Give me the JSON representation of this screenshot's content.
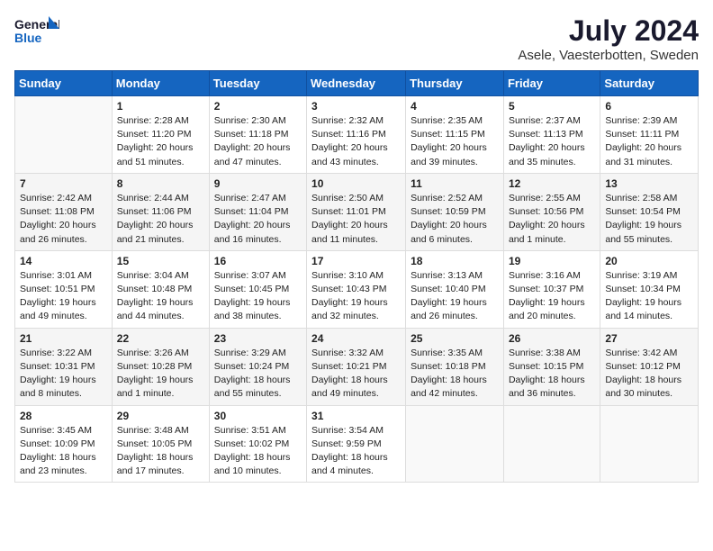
{
  "header": {
    "logo_line1": "General",
    "logo_line2": "Blue",
    "month": "July 2024",
    "location": "Asele, Vaesterbotten, Sweden"
  },
  "weekdays": [
    "Sunday",
    "Monday",
    "Tuesday",
    "Wednesday",
    "Thursday",
    "Friday",
    "Saturday"
  ],
  "weeks": [
    [
      {
        "day": "",
        "data": ""
      },
      {
        "day": "1",
        "data": "Sunrise: 2:28 AM\nSunset: 11:20 PM\nDaylight: 20 hours\nand 51 minutes."
      },
      {
        "day": "2",
        "data": "Sunrise: 2:30 AM\nSunset: 11:18 PM\nDaylight: 20 hours\nand 47 minutes."
      },
      {
        "day": "3",
        "data": "Sunrise: 2:32 AM\nSunset: 11:16 PM\nDaylight: 20 hours\nand 43 minutes."
      },
      {
        "day": "4",
        "data": "Sunrise: 2:35 AM\nSunset: 11:15 PM\nDaylight: 20 hours\nand 39 minutes."
      },
      {
        "day": "5",
        "data": "Sunrise: 2:37 AM\nSunset: 11:13 PM\nDaylight: 20 hours\nand 35 minutes."
      },
      {
        "day": "6",
        "data": "Sunrise: 2:39 AM\nSunset: 11:11 PM\nDaylight: 20 hours\nand 31 minutes."
      }
    ],
    [
      {
        "day": "7",
        "data": "Sunrise: 2:42 AM\nSunset: 11:08 PM\nDaylight: 20 hours\nand 26 minutes."
      },
      {
        "day": "8",
        "data": "Sunrise: 2:44 AM\nSunset: 11:06 PM\nDaylight: 20 hours\nand 21 minutes."
      },
      {
        "day": "9",
        "data": "Sunrise: 2:47 AM\nSunset: 11:04 PM\nDaylight: 20 hours\nand 16 minutes."
      },
      {
        "day": "10",
        "data": "Sunrise: 2:50 AM\nSunset: 11:01 PM\nDaylight: 20 hours\nand 11 minutes."
      },
      {
        "day": "11",
        "data": "Sunrise: 2:52 AM\nSunset: 10:59 PM\nDaylight: 20 hours\nand 6 minutes."
      },
      {
        "day": "12",
        "data": "Sunrise: 2:55 AM\nSunset: 10:56 PM\nDaylight: 20 hours\nand 1 minute."
      },
      {
        "day": "13",
        "data": "Sunrise: 2:58 AM\nSunset: 10:54 PM\nDaylight: 19 hours\nand 55 minutes."
      }
    ],
    [
      {
        "day": "14",
        "data": "Sunrise: 3:01 AM\nSunset: 10:51 PM\nDaylight: 19 hours\nand 49 minutes."
      },
      {
        "day": "15",
        "data": "Sunrise: 3:04 AM\nSunset: 10:48 PM\nDaylight: 19 hours\nand 44 minutes."
      },
      {
        "day": "16",
        "data": "Sunrise: 3:07 AM\nSunset: 10:45 PM\nDaylight: 19 hours\nand 38 minutes."
      },
      {
        "day": "17",
        "data": "Sunrise: 3:10 AM\nSunset: 10:43 PM\nDaylight: 19 hours\nand 32 minutes."
      },
      {
        "day": "18",
        "data": "Sunrise: 3:13 AM\nSunset: 10:40 PM\nDaylight: 19 hours\nand 26 minutes."
      },
      {
        "day": "19",
        "data": "Sunrise: 3:16 AM\nSunset: 10:37 PM\nDaylight: 19 hours\nand 20 minutes."
      },
      {
        "day": "20",
        "data": "Sunrise: 3:19 AM\nSunset: 10:34 PM\nDaylight: 19 hours\nand 14 minutes."
      }
    ],
    [
      {
        "day": "21",
        "data": "Sunrise: 3:22 AM\nSunset: 10:31 PM\nDaylight: 19 hours\nand 8 minutes."
      },
      {
        "day": "22",
        "data": "Sunrise: 3:26 AM\nSunset: 10:28 PM\nDaylight: 19 hours\nand 1 minute."
      },
      {
        "day": "23",
        "data": "Sunrise: 3:29 AM\nSunset: 10:24 PM\nDaylight: 18 hours\nand 55 minutes."
      },
      {
        "day": "24",
        "data": "Sunrise: 3:32 AM\nSunset: 10:21 PM\nDaylight: 18 hours\nand 49 minutes."
      },
      {
        "day": "25",
        "data": "Sunrise: 3:35 AM\nSunset: 10:18 PM\nDaylight: 18 hours\nand 42 minutes."
      },
      {
        "day": "26",
        "data": "Sunrise: 3:38 AM\nSunset: 10:15 PM\nDaylight: 18 hours\nand 36 minutes."
      },
      {
        "day": "27",
        "data": "Sunrise: 3:42 AM\nSunset: 10:12 PM\nDaylight: 18 hours\nand 30 minutes."
      }
    ],
    [
      {
        "day": "28",
        "data": "Sunrise: 3:45 AM\nSunset: 10:09 PM\nDaylight: 18 hours\nand 23 minutes."
      },
      {
        "day": "29",
        "data": "Sunrise: 3:48 AM\nSunset: 10:05 PM\nDaylight: 18 hours\nand 17 minutes."
      },
      {
        "day": "30",
        "data": "Sunrise: 3:51 AM\nSunset: 10:02 PM\nDaylight: 18 hours\nand 10 minutes."
      },
      {
        "day": "31",
        "data": "Sunrise: 3:54 AM\nSunset: 9:59 PM\nDaylight: 18 hours\nand 4 minutes."
      },
      {
        "day": "",
        "data": ""
      },
      {
        "day": "",
        "data": ""
      },
      {
        "day": "",
        "data": ""
      }
    ]
  ]
}
